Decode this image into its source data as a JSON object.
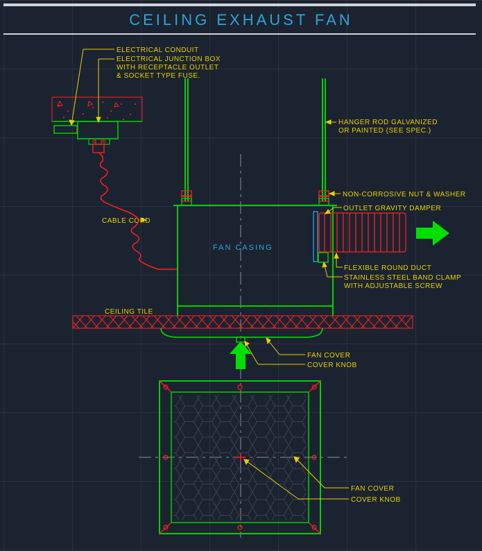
{
  "title": "CEILING  EXHAUST  FAN",
  "labels": {
    "electrical_conduit": "ELECTRICAL CONDUIT",
    "junction_box": "ELECTRICAL JUNCTION BOX\nWITH RECEPTACLE OUTLET\n& SOCKET TYPE FUSE.",
    "hanger_rod": "HANGER ROD GALVANIZED\nOR PAINTED (SEE SPEC.)",
    "nut_washer": "NON-CORROSIVE NUT & WASHER",
    "gravity_damper": "OUTLET GRAVITY DAMPER",
    "cable_cord": "CABLE CORD",
    "fan_casing": "FAN CASING",
    "flexible_duct": "FLEXIBLE ROUND DUCT",
    "band_clamp": "STAINLESS STEEL BAND CLAMP\nWITH ADJUSTABLE SCREW",
    "ceiling_tile": "CEILING TILE",
    "fan_cover": "FAN COVER",
    "cover_knob": "COVER KNOB",
    "fan_cover2": "FAN COVER",
    "cover_knob2": "COVER KNOB"
  },
  "colors": {
    "yellow": "#e6d200",
    "cyan": "#2da5d6",
    "green": "#00d000",
    "red": "#ff2020",
    "bright_green": "#00e000"
  }
}
